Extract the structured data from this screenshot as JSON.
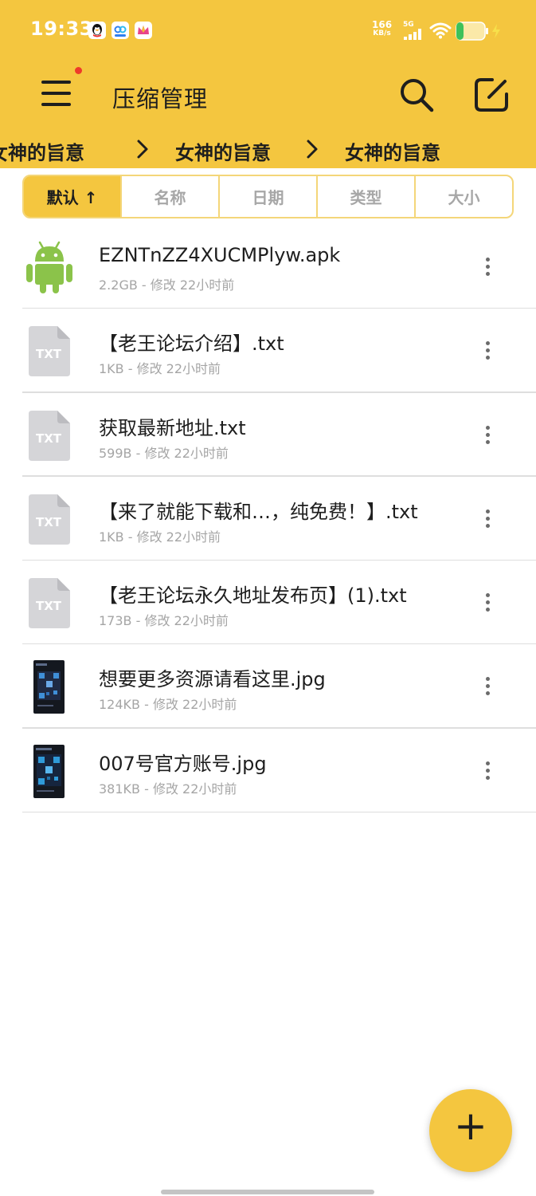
{
  "status_bar": {
    "time": "19:33",
    "net_speed": "166",
    "net_unit": "KB/s",
    "signal_label": "5G",
    "notification_icons": [
      "qq-icon",
      "cloud-app-icon",
      "crown-app-icon"
    ]
  },
  "header": {
    "title": "压缩管理",
    "has_menu_badge": true,
    "accent_color": "#f4c63f"
  },
  "breadcrumbs": [
    "女神的旨意",
    "女神的旨意",
    "女神的旨意"
  ],
  "sort_tabs": [
    {
      "label": "默认 ↑",
      "active": true
    },
    {
      "label": "名称",
      "active": false
    },
    {
      "label": "日期",
      "active": false
    },
    {
      "label": "类型",
      "active": false
    },
    {
      "label": "大小",
      "active": false
    }
  ],
  "files": [
    {
      "name": "EZNTnZZ4XUCMPlyw.apk",
      "meta": "2.2GB - 修改 22小时前",
      "type": "apk",
      "icon_label": ""
    },
    {
      "name": "【老王论坛介绍】.txt",
      "meta": "1KB - 修改 22小时前",
      "type": "txt",
      "icon_label": "TXT"
    },
    {
      "name": "获取最新地址.txt",
      "meta": "599B - 修改 22小时前",
      "type": "txt",
      "icon_label": "TXT"
    },
    {
      "name": "【来了就能下载和…，纯免费！】.txt",
      "meta": "1KB - 修改 22小时前",
      "type": "txt",
      "icon_label": "TXT"
    },
    {
      "name": "【老王论坛永久地址发布页】(1).txt",
      "meta": "173B - 修改 22小时前",
      "type": "txt",
      "icon_label": "TXT"
    },
    {
      "name": "想要更多资源请看这里.jpg",
      "meta": "124KB - 修改 22小时前",
      "type": "jpg",
      "icon_label": ""
    },
    {
      "name": "007号官方账号.jpg",
      "meta": "381KB - 修改 22小时前",
      "type": "jpg",
      "icon_label": ""
    }
  ],
  "fab": {
    "label": "+"
  }
}
